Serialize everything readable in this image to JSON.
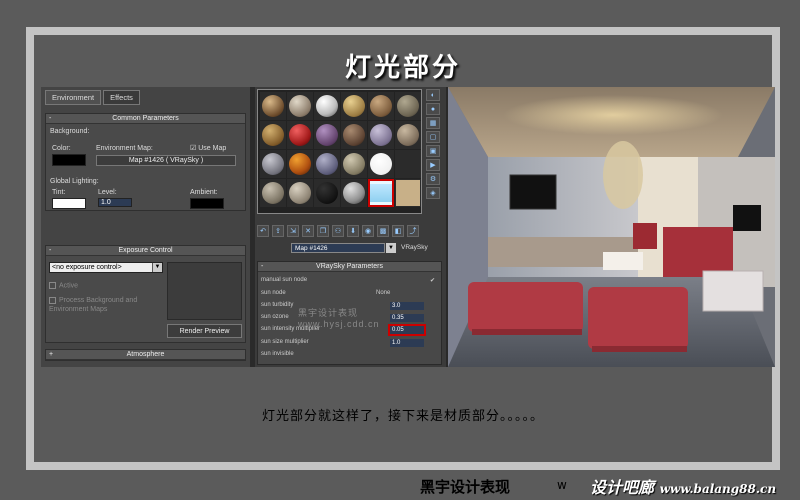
{
  "title": "灯光部分",
  "caption": "灯光部分就这样了，接下来是材质部分。。。。。",
  "footer": {
    "brand": "黑宇设计表现",
    "left_fragment": "w",
    "watermark_text": "设计吧廊",
    "watermark_url": "www.balang88.cn"
  },
  "env_panel": {
    "tabs": [
      "Environment",
      "Effects"
    ],
    "common_params": {
      "header": "Common Parameters",
      "background_label": "Background:",
      "color_label": "Color:",
      "env_map_label": "Environment Map:",
      "use_map_label": "Use Map",
      "use_map_checked": true,
      "map_button": "Map #1426  ( VRaySky )",
      "global_lighting_label": "Global Lighting:",
      "tint_label": "Tint:",
      "level_label": "Level:",
      "level_value": "1.0",
      "ambient_label": "Ambient:"
    },
    "exposure": {
      "header": "Exposure Control",
      "dropdown_value": "<no exposure control>",
      "active_label": "Active",
      "process_label": "Process Background and Environment Maps",
      "render_preview": "Render Preview"
    },
    "atmosphere_header": "Atmosphere"
  },
  "material_editor": {
    "map_name": "Map #1426",
    "map_type": "VRaySky",
    "rollout_header": "VRaySky Parameters",
    "params": [
      {
        "label": "manual sun node",
        "value": "✔"
      },
      {
        "label": "sun node",
        "value": "None"
      },
      {
        "label": "sun turbidity",
        "value": "3.0"
      },
      {
        "label": "sun ozone",
        "value": "0.35"
      },
      {
        "label": "sun intensity multiplier",
        "value": "0.05"
      },
      {
        "label": "sun size multiplier",
        "value": "1.0"
      },
      {
        "label": "sun invisible",
        "value": ""
      }
    ],
    "watermark": "黑宇设计表现 www.hysj.cdd.cn"
  }
}
